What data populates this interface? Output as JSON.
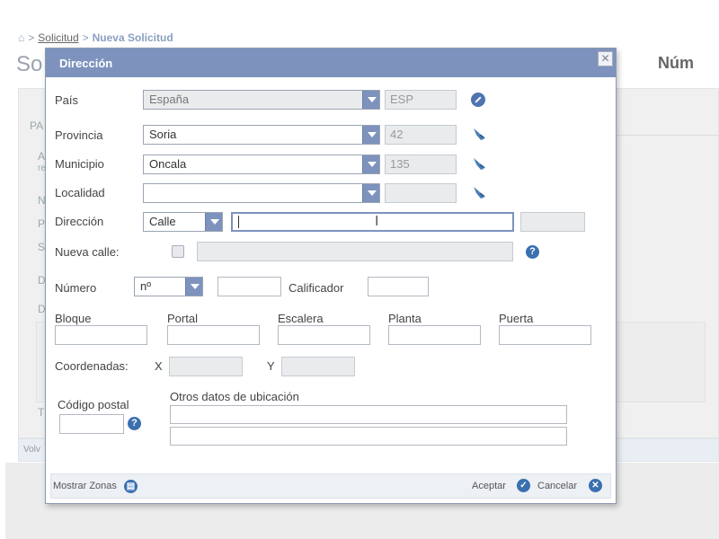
{
  "background": {
    "breadcrumb": {
      "home_icon": "home-icon",
      "sep1": ">",
      "link": "Solicitud",
      "sep2": ">",
      "current": "Nueva Solicitud"
    },
    "title_fragment": "So",
    "right_fragment": "Núm",
    "left_fragments": [
      "PA",
      "A",
      "re",
      "N",
      "P",
      "S",
      "D",
      "D",
      "T"
    ],
    "bottom_bar_text": "Volv"
  },
  "modal": {
    "title": "Dirección",
    "close_icon": "close-icon",
    "pais": {
      "label": "País",
      "value": "España",
      "code": "ESP"
    },
    "provincia": {
      "label": "Provincia",
      "value": "Soria",
      "code": "42"
    },
    "municipio": {
      "label": "Municipio",
      "value": "Oncala",
      "code": "135"
    },
    "localidad": {
      "label": "Localidad",
      "value": "",
      "code": ""
    },
    "direccion": {
      "label": "Dirección",
      "type_value": "Calle",
      "street_value": "",
      "extra": ""
    },
    "nueva_calle": {
      "label": "Nueva calle:",
      "value": ""
    },
    "numero": {
      "label": "Número",
      "type_value": "nº",
      "value": "",
      "calificador_label": "Calificador",
      "calificador_value": ""
    },
    "bloque": {
      "label": "Bloque",
      "value": ""
    },
    "portal": {
      "label": "Portal",
      "value": ""
    },
    "escalera": {
      "label": "Escalera",
      "value": ""
    },
    "planta": {
      "label": "Planta",
      "value": ""
    },
    "puerta": {
      "label": "Puerta",
      "value": ""
    },
    "coordenadas": {
      "label": "Coordenadas:",
      "x_label": "X",
      "y_label": "Y",
      "x_value": "",
      "y_value": ""
    },
    "codigo_postal": {
      "label": "Código postal",
      "value": ""
    },
    "otros": {
      "label": "Otros datos de ubicación",
      "line1": "",
      "line2": ""
    },
    "help_glyph": "?",
    "footer": {
      "mostrar_zonas": "Mostrar Zonas",
      "aceptar": "Aceptar",
      "cancelar": "Cancelar"
    }
  },
  "colors": {
    "header": "#7d93bd",
    "accent": "#3a6fb0"
  }
}
